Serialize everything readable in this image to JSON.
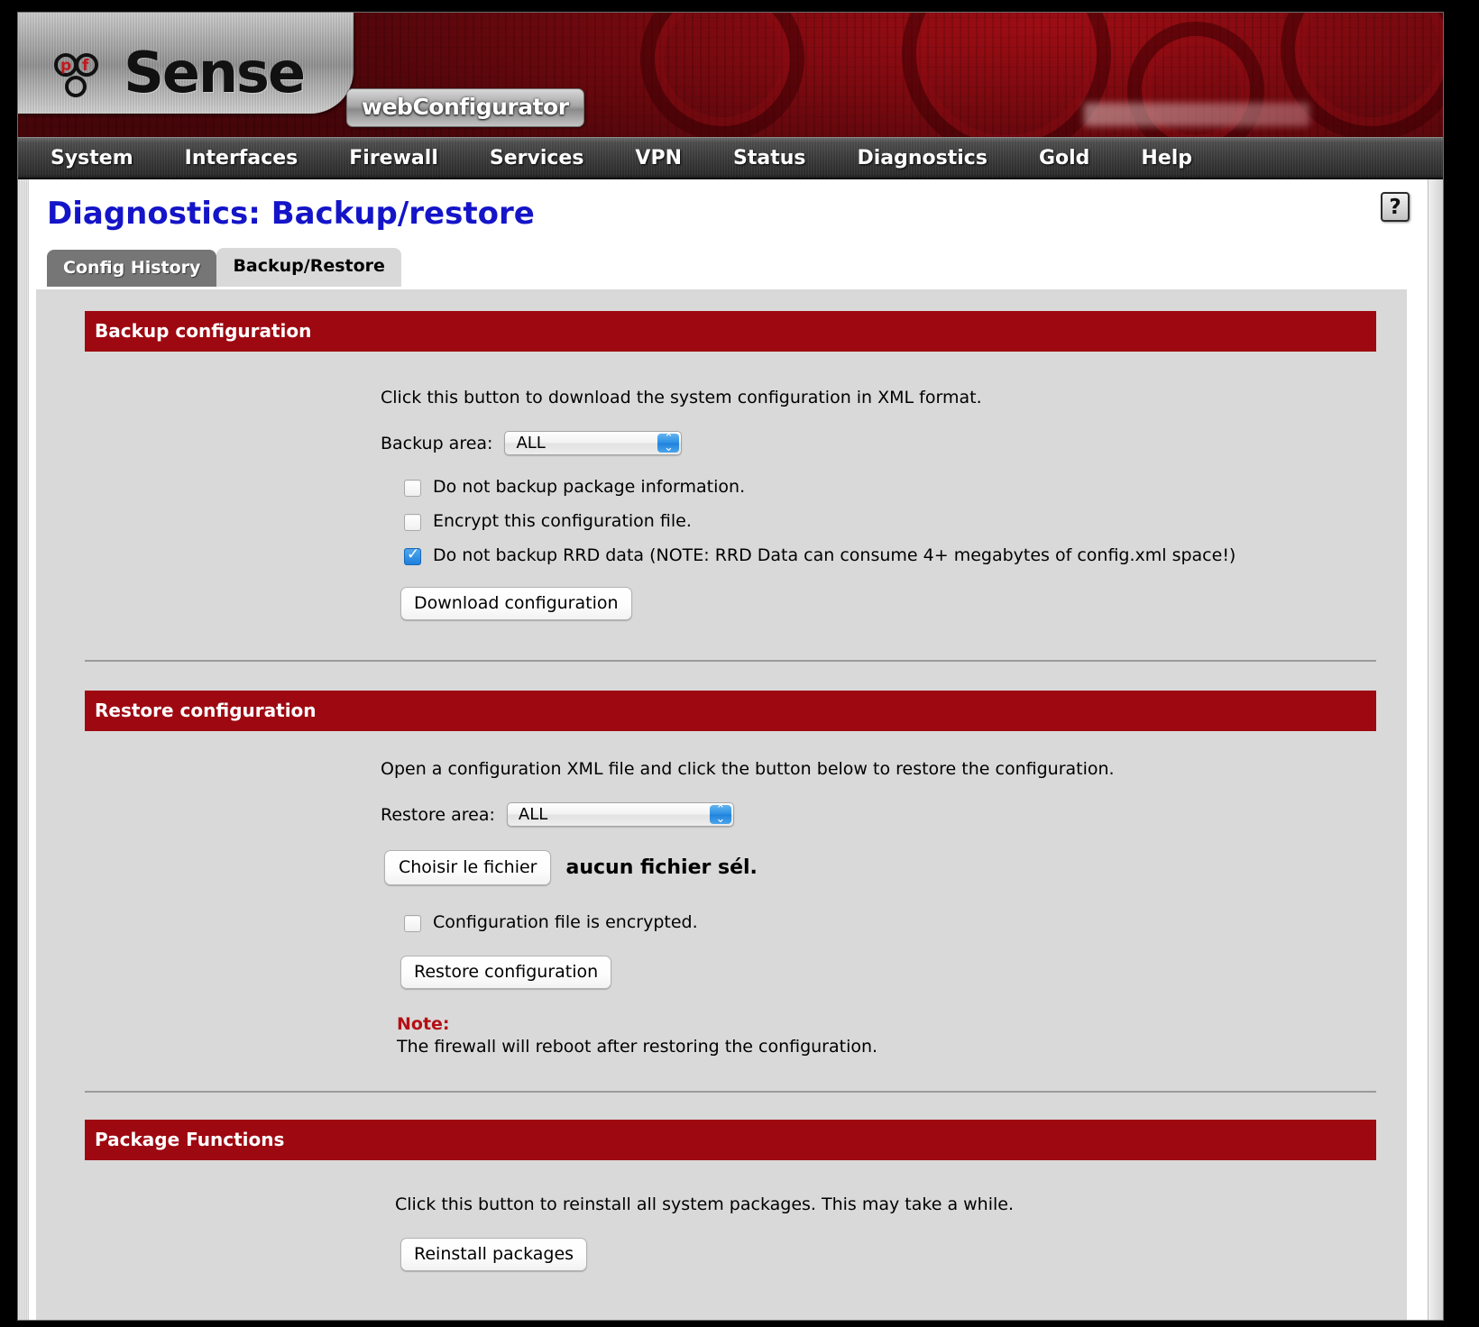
{
  "brand": {
    "logo_text_pf": "pf",
    "logo_text_sense": "Sense",
    "webconfigurator_label": "webConfigurator"
  },
  "nav": {
    "items": [
      {
        "label": "System"
      },
      {
        "label": "Interfaces"
      },
      {
        "label": "Firewall"
      },
      {
        "label": "Services"
      },
      {
        "label": "VPN"
      },
      {
        "label": "Status"
      },
      {
        "label": "Diagnostics"
      },
      {
        "label": "Gold"
      },
      {
        "label": "Help"
      }
    ]
  },
  "page": {
    "title": "Diagnostics: Backup/restore",
    "help_icon_label": "?"
  },
  "tabs": [
    {
      "label": "Config History",
      "active": false
    },
    {
      "label": "Backup/Restore",
      "active": true
    }
  ],
  "backup": {
    "header": "Backup configuration",
    "description": "Click this button to download the system configuration in XML format.",
    "area_label": "Backup area:",
    "area_value": "ALL",
    "options": [
      {
        "label": "Do not backup package information.",
        "checked": false
      },
      {
        "label": "Encrypt this configuration file.",
        "checked": false
      },
      {
        "label": "Do not backup RRD data (NOTE: RRD Data can consume 4+ megabytes of config.xml space!)",
        "checked": true
      }
    ],
    "download_button": "Download configuration"
  },
  "restore": {
    "header": "Restore configuration",
    "description": "Open a configuration XML file and click the button below to restore the configuration.",
    "area_label": "Restore area:",
    "area_value": "ALL",
    "file_button": "Choisir le fichier",
    "file_status": "aucun fichier sél.",
    "encrypted_option": "Configuration file is encrypted.",
    "encrypted_checked": false,
    "restore_button": "Restore configuration",
    "note_label": "Note:",
    "note_text": "The firewall will reboot after restoring the configuration."
  },
  "packages": {
    "header": "Package Functions",
    "description": "Click this button to reinstall all system packages. This may take a while.",
    "reinstall_button": "Reinstall packages"
  },
  "colors": {
    "brand_red": "#9e0811",
    "title_blue": "#1414c8",
    "panel_grey": "#d9d9d9",
    "note_red": "#b40f15"
  }
}
